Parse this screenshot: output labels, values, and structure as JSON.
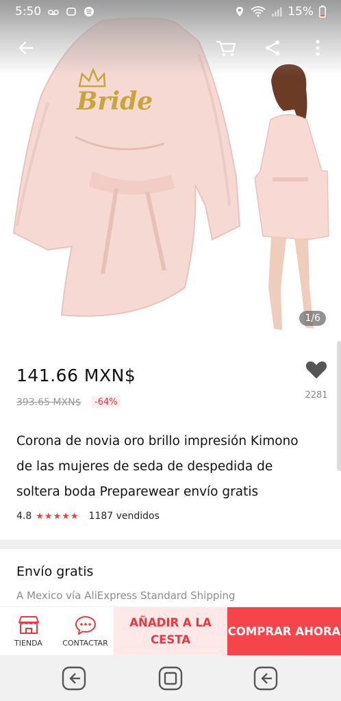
{
  "status_bar": {
    "time": "5:50",
    "battery": "15%"
  },
  "gallery": {
    "page_indicator": "1/6",
    "logo_text": "Bride"
  },
  "product": {
    "price": "141.66 MXN$",
    "old_price": "393.65 MXN$",
    "discount": "-64%",
    "wishlist_count": "2281",
    "title": "Corona de novia oro brillo impresión Kimono de las mujeres de seda de despedida de soltera boda Preparewear envío gratis",
    "rating": "4.8",
    "stars": "★★★★★",
    "sold": "1187 vendidos"
  },
  "shipping": {
    "title": "Envío gratis",
    "subtitle": "A Mexico vía AliExpress Standard Shipping"
  },
  "actions": {
    "store_label": "TIENDA",
    "contact_label": "CONTACTAR",
    "add_to_cart": "AÑADIR A LA CESTA",
    "buy_now": "COMPRAR AHORA"
  },
  "colors": {
    "accent": "#f5454a",
    "accent_light": "#ffe8e8",
    "star": "#f03d3d"
  }
}
